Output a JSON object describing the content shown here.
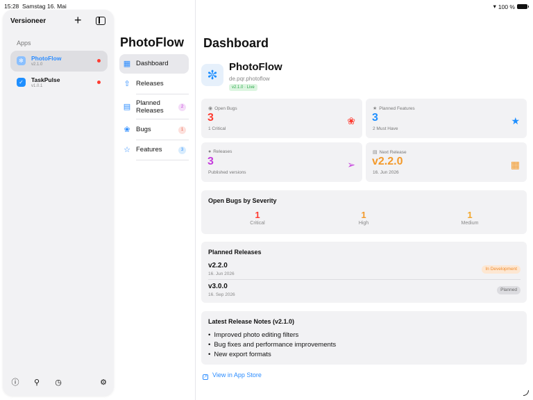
{
  "status_bar": {
    "time": "15:28",
    "date": "Samstag 16. Mai",
    "battery": "100 %"
  },
  "sidebar": {
    "title": "Versioneer",
    "section": "Apps",
    "apps": [
      {
        "name": "PhotoFlow",
        "version": "v2.1.0",
        "selected": true
      },
      {
        "name": "TaskPulse",
        "version": "v1.0.1",
        "selected": false
      }
    ]
  },
  "nav": {
    "title": "PhotoFlow",
    "items": [
      {
        "label": "Dashboard"
      },
      {
        "label": "Releases"
      },
      {
        "label": "Planned Releases",
        "label_line1": "Planned",
        "label_line2": "Releases",
        "badge": "2"
      },
      {
        "label": "Bugs",
        "badge": "1"
      },
      {
        "label": "Features",
        "badge": "3"
      }
    ]
  },
  "main": {
    "title": "Dashboard",
    "app": {
      "name": "PhotoFlow",
      "bundle_id": "de.pqr.photoflow",
      "badge": "v2.1.0 · Live"
    },
    "stats": {
      "open_bugs": {
        "label": "Open Bugs",
        "value": "3",
        "sub": "1 Critical"
      },
      "planned_features": {
        "label": "Planned Features",
        "value": "3",
        "sub": "2 Must Have"
      },
      "releases": {
        "label": "Releases",
        "value": "3",
        "sub": "Published versions"
      },
      "next_release": {
        "label": "Next Release",
        "value": "v2.2.0",
        "sub": "16. Jun 2026"
      }
    },
    "severity": {
      "title": "Open Bugs by Severity",
      "items": [
        {
          "value": "1",
          "label": "Critical"
        },
        {
          "value": "1",
          "label": "High"
        },
        {
          "value": "1",
          "label": "Medium"
        }
      ]
    },
    "planned_releases": {
      "title": "Planned Releases",
      "items": [
        {
          "version": "v2.2.0",
          "date": "16. Jun 2026",
          "status": "In Development"
        },
        {
          "version": "v3.0.0",
          "date": "16. Sep 2026",
          "status": "Planned"
        }
      ]
    },
    "release_notes": {
      "title": "Latest Release Notes (v2.1.0)",
      "items": [
        "Improved photo editing filters",
        "Bug fixes and performance improvements",
        "New export formats"
      ]
    },
    "store_link": "View in App Store"
  },
  "colors": {
    "accent": "#2b8cff",
    "bugs": "#ff3b30",
    "features": "#1f8fff",
    "releases": "#c43bdc",
    "next_release": "#f39a2b",
    "high": "#f39a2b"
  }
}
